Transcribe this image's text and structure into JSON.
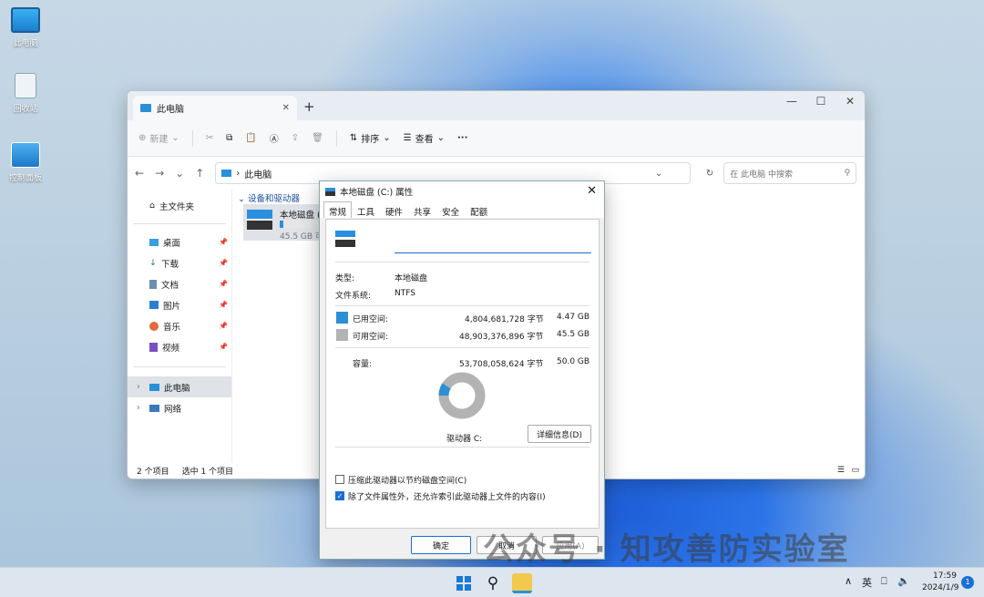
{
  "desktop": {
    "icons": [
      {
        "label": "此电脑"
      },
      {
        "label": "回收站"
      },
      {
        "label": "控制面板"
      }
    ]
  },
  "explorer": {
    "tab_title": "此电脑",
    "toolbar": {
      "new": "新建",
      "sort": "排序",
      "view": "查看",
      "more": "···"
    },
    "address": {
      "path": "此电脑",
      "search_placeholder": "在 此电脑 中搜索"
    },
    "sidebar": {
      "home": "主文件夹",
      "items": [
        {
          "label": "桌面"
        },
        {
          "label": "下载"
        },
        {
          "label": "文档"
        },
        {
          "label": "图片"
        },
        {
          "label": "音乐"
        },
        {
          "label": "视频"
        }
      ],
      "this_pc": "此电脑",
      "network": "网络"
    },
    "main": {
      "group": "设备和驱动器",
      "drive_name": "本地磁盘 (C:)",
      "drive_free": "45.5 GB 可用"
    },
    "status": {
      "count": "2 个项目",
      "selected": "选中 1 个项目"
    }
  },
  "dialog": {
    "title": "本地磁盘 (C:) 属性",
    "tabs": [
      "常规",
      "工具",
      "硬件",
      "共享",
      "安全",
      "配额"
    ],
    "name_value": "",
    "type_label": "类型:",
    "type_value": "本地磁盘",
    "fs_label": "文件系统:",
    "fs_value": "NTFS",
    "used_label": "已用空间:",
    "used_bytes": "4,804,681,728 字节",
    "used_gb": "4.47 GB",
    "free_label": "可用空间:",
    "free_bytes": "48,903,376,896 字节",
    "free_gb": "45.5 GB",
    "cap_label": "容量:",
    "cap_bytes": "53,708,058,624 字节",
    "cap_gb": "50.0 GB",
    "used_fraction": 0.089,
    "drive_label": "驱动器 C:",
    "details_button": "详细信息(D)",
    "compress": "压缩此驱动器以节约磁盘空间(C)",
    "index": "除了文件属性外，还允许索引此驱动器上文件的内容(I)",
    "ok": "确定",
    "cancel": "取消",
    "apply": "应用(A)",
    "colors": {
      "used": "#2d8fd6",
      "free": "#b3b3b3"
    }
  },
  "taskbar": {
    "lang": "英",
    "time": "17:59",
    "date": "2024/1/9",
    "badge": "1"
  },
  "watermark": "公众号 · 知攻善防实验室"
}
